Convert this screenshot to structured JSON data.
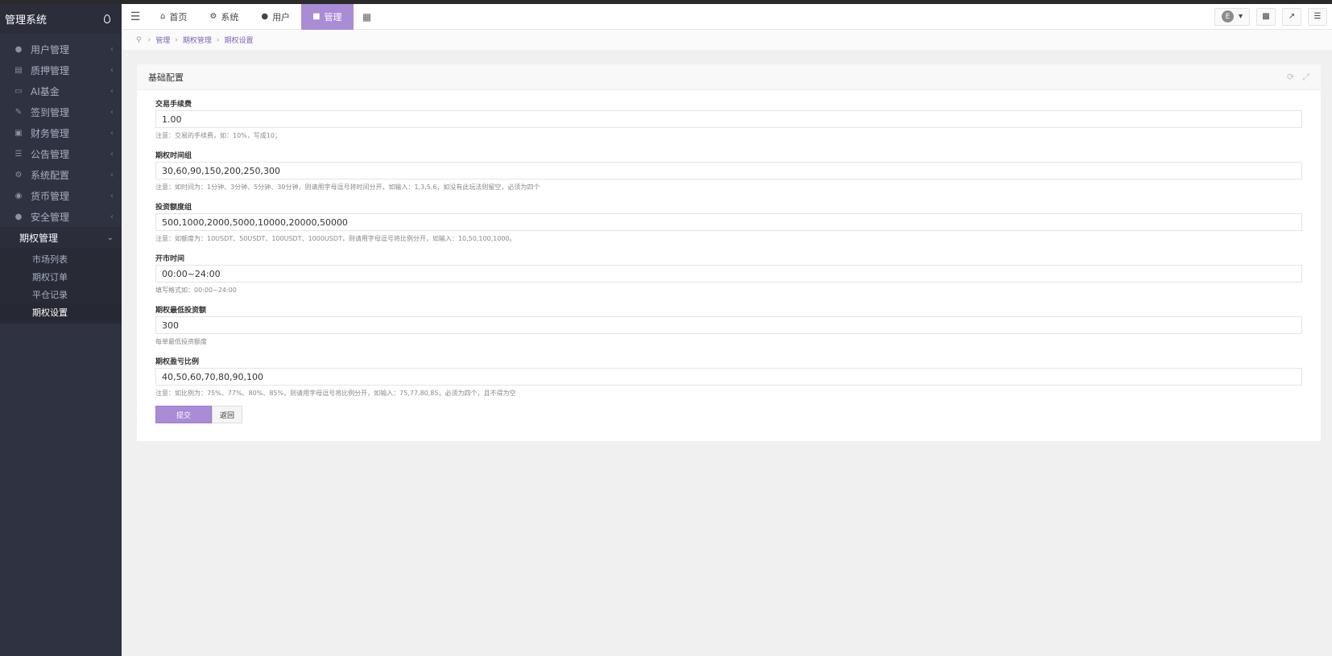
{
  "app": {
    "title": "管理系统"
  },
  "sidebar": {
    "items": [
      {
        "label": "用户管理",
        "icon": "user-icon"
      },
      {
        "label": "质押管理",
        "icon": "credit-card-icon"
      },
      {
        "label": "AI基金",
        "icon": "monitor-icon"
      },
      {
        "label": "签到管理",
        "icon": "edit-icon"
      },
      {
        "label": "财务管理",
        "icon": "book-icon"
      },
      {
        "label": "公告管理",
        "icon": "list-icon"
      },
      {
        "label": "系统配置",
        "icon": "cogs-icon"
      },
      {
        "label": "货币管理",
        "icon": "coin-icon"
      },
      {
        "label": "安全管理",
        "icon": "lock-icon"
      },
      {
        "label": "期权管理",
        "icon": "",
        "expanded": true
      }
    ],
    "subitems": [
      {
        "label": "市场列表"
      },
      {
        "label": "期权订单"
      },
      {
        "label": "平仓记录"
      },
      {
        "label": "期权设置",
        "active": true
      }
    ]
  },
  "navbar": {
    "tabs": [
      {
        "label": "首页",
        "icon": "home-icon"
      },
      {
        "label": "系统",
        "icon": "gear-icon"
      },
      {
        "label": "用户",
        "icon": "user-icon"
      },
      {
        "label": "管理",
        "icon": "briefcase-icon",
        "active": true
      }
    ],
    "avatar_letter": "E"
  },
  "breadcrumb": [
    "管理",
    "期权管理",
    "期权设置"
  ],
  "panel": {
    "title": "基础配置",
    "fields": [
      {
        "label": "交易手续费",
        "value": "1.00",
        "hint": "注意：交易的手续费，如：10%，写成10；"
      },
      {
        "label": "期权时间组",
        "value": "30,60,90,150,200,250,300",
        "hint": "注意：如时间为：1分钟、3分钟、5分钟、30分钟，则请用字母逗号将时间分开，如输入：1,3,5,6，如没有此玩法则留空，必须为四个"
      },
      {
        "label": "投资额度组",
        "value": "500,1000,2000,5000,10000,20000,50000",
        "hint": "注意：如额度为：10USDT、50USDT、100USDT、1000USDT，则请用字母逗号将比例分开，如输入：10,50,100,1000。"
      },
      {
        "label": "开市时间",
        "value": "00:00~24:00",
        "hint": "填写格式如：00:00~24:00"
      },
      {
        "label": "期权最低投资额",
        "value": "300",
        "hint": "每单最低投资额度"
      },
      {
        "label": "期权盈亏比例",
        "value": "40,50,60,70,80,90,100",
        "hint": "注意：如比例为：75%、77%、80%、85%，则请用字母逗号将比例分开，如输入：75,77,80,85，必须为四个，且不得为空"
      }
    ],
    "submit_label": "提交",
    "back_label": "返回"
  },
  "colors": {
    "accent": "#a98bd6",
    "sidebar_bg": "#2f3241"
  }
}
